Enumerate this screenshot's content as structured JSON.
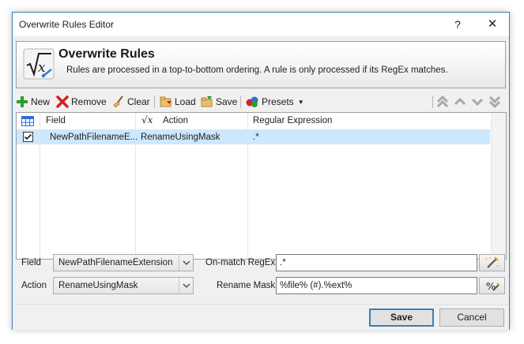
{
  "window": {
    "title": "Overwrite Rules Editor",
    "help_label": "?",
    "close_label": "✕"
  },
  "header": {
    "title": "Overwrite Rules",
    "description": "Rules are processed in a top-to-bottom ordering. A rule is only processed if its RegEx matches."
  },
  "toolbar": {
    "new_label": "New",
    "remove_label": "Remove",
    "clear_label": "Clear",
    "load_label": "Load",
    "save_label": "Save",
    "presets_label": "Presets"
  },
  "grid": {
    "columns": [
      "Field",
      "Action",
      "Regular Expression"
    ],
    "rows": [
      {
        "checked": true,
        "field": "NewPathFilenameE...",
        "action": "RenameUsingMask",
        "regex": ".*"
      }
    ]
  },
  "form": {
    "field_label": "Field",
    "field_value": "NewPathFilenameExtension",
    "action_label": "Action",
    "action_value": "RenameUsingMask",
    "onmatch_label": "On-match RegEx",
    "onmatch_value": ".*",
    "mask_label": "Rename Mask",
    "mask_value": "%file% (#).%ext%"
  },
  "footer": {
    "save_label": "Save",
    "cancel_label": "Cancel"
  },
  "colors": {
    "selection": "#cce8ff",
    "accent": "#3c7fb1"
  }
}
